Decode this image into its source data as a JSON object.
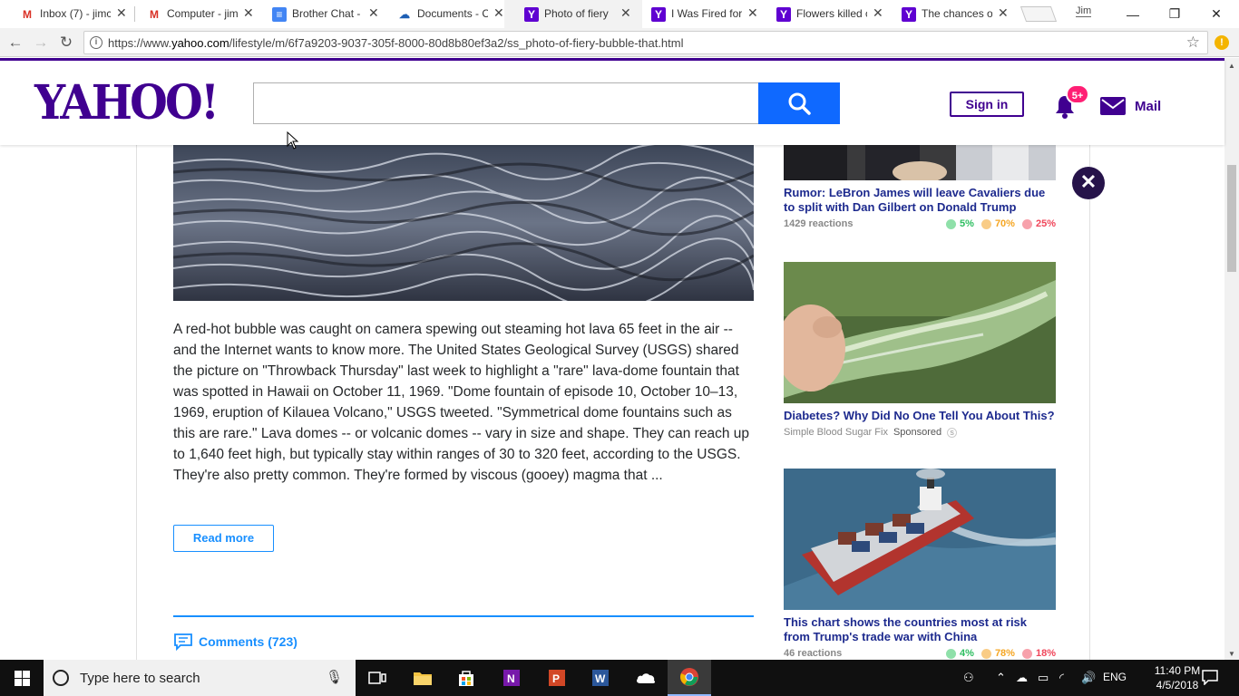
{
  "browser": {
    "tabs": [
      {
        "title": "Inbox (7) - jimc",
        "icon": "gmail-icon",
        "active": false
      },
      {
        "title": "Computer - jim",
        "icon": "gmail-icon",
        "active": false
      },
      {
        "title": "Brother Chat -",
        "icon": "docs-icon",
        "active": false
      },
      {
        "title": "Documents - C",
        "icon": "onedrive-icon",
        "active": false
      },
      {
        "title": "Photo of fiery",
        "icon": "yahoo-icon",
        "active": true
      },
      {
        "title": "I Was Fired for",
        "icon": "yahoo-icon",
        "active": false
      },
      {
        "title": "Flowers killed c",
        "icon": "yahoo-icon",
        "active": false
      },
      {
        "title": "The chances of",
        "icon": "yahoo-icon",
        "active": false
      }
    ],
    "profile_name": "Jim",
    "url_prefix": "https://www.",
    "url_domain": "yahoo.com",
    "url_path": "/lifestyle/m/6f7a9203-9037-305f-8000-80d8b80ef3a2/ss_photo-of-fiery-bubble-that.html"
  },
  "header": {
    "logo": "YAHOO!",
    "search_value": "",
    "signin_label": "Sign in",
    "notification_badge": "5+",
    "mail_label": "Mail"
  },
  "article": {
    "body": "A red-hot bubble was caught on camera spewing out steaming hot lava 65 feet in the air -- and the Internet wants to know more. The United States Geological Survey (USGS) shared the picture on \"Throwback Thursday\" last week to highlight a \"rare\" lava-dome fountain that was spotted in Hawaii on October 11, 1969. \"Dome fountain of episode 10, October 10–13, 1969, eruption of Kilauea Volcano,\" USGS tweeted. \"Symmetrical dome fountains such as this are rare.\" Lava domes -- or volcanic domes -- vary in size and shape. They can reach up to 1,640 feet high, but typically stay within ranges of 30 to 320 feet, according to the USGS. They're also pretty common. They're formed by viscous (gooey) magma that ...",
    "read_more_label": "Read more",
    "comments_label": "Comments (723)"
  },
  "rail": {
    "items": [
      {
        "title": "Rumor: LeBron James will leave Cavaliers due to split with Dan Gilbert on Donald Trump",
        "meta": "1429 reactions",
        "reactions": [
          "5%",
          "70%",
          "25%"
        ]
      },
      {
        "title": "Diabetes? Why Did No One Tell You About This?",
        "source": "Simple Blood Sugar Fix",
        "sponsored": "Sponsored"
      },
      {
        "title": "This chart shows the countries most at risk from Trump's trade war with China",
        "meta": "46 reactions",
        "reactions": [
          "4%",
          "78%",
          "18%"
        ]
      }
    ]
  },
  "taskbar": {
    "search_placeholder": "Type here to search",
    "language": "ENG",
    "time": "11:40 PM",
    "date": "4/5/2018"
  }
}
